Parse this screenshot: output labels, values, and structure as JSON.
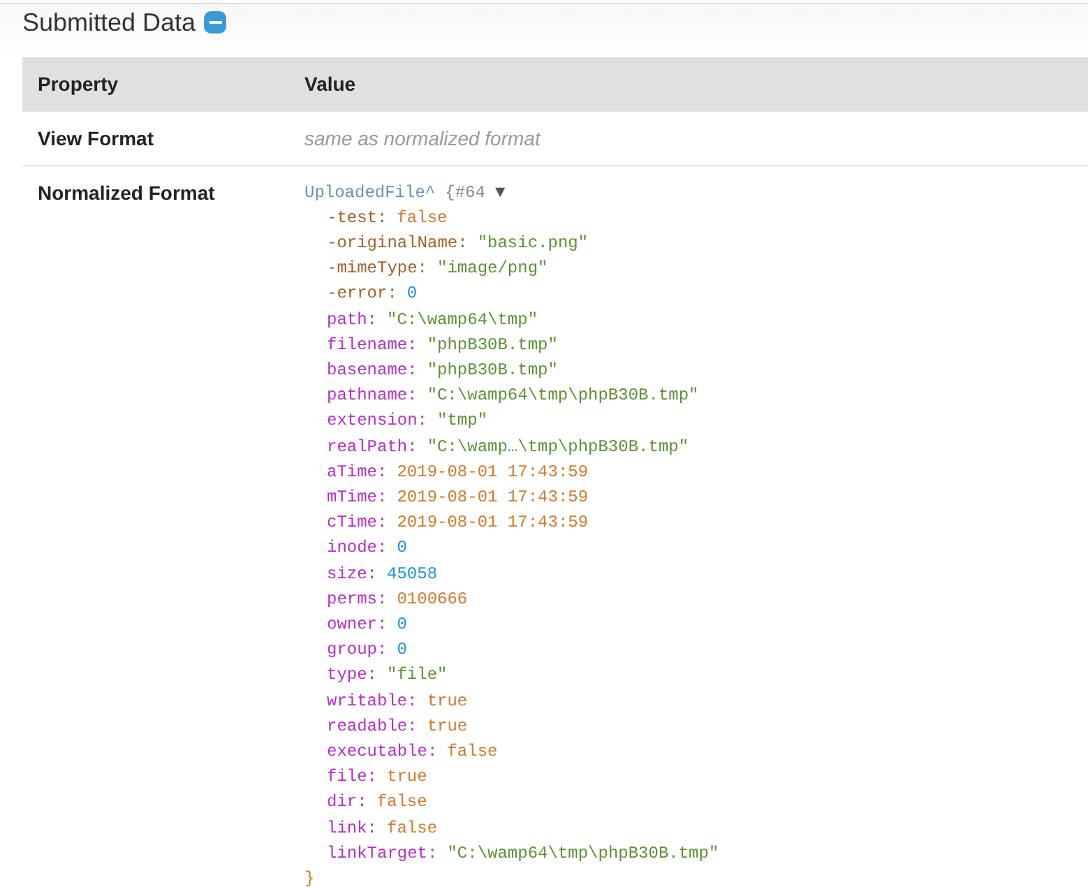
{
  "section": {
    "title": "Submitted Data",
    "expanded": true
  },
  "table": {
    "columns": [
      "Property",
      "Value"
    ],
    "rows": [
      {
        "property": "View Format",
        "kind": "note",
        "value": "same as normalized format"
      },
      {
        "property": "Normalized Format",
        "kind": "dump",
        "dump": {
          "class": "UploadedFile^",
          "ref": "{#64",
          "toggle": "▼",
          "close": "}",
          "expanded": true,
          "protected_fields": [
            {
              "key": "-test:",
              "kind": "const",
              "value": "false"
            },
            {
              "key": "-originalName:",
              "kind": "string",
              "value": "\"basic.png\""
            },
            {
              "key": "-mimeType:",
              "kind": "string",
              "value": "\"image/png\""
            },
            {
              "key": "-error:",
              "kind": "number",
              "value": "0"
            }
          ],
          "public_fields": [
            {
              "key": "path:",
              "kind": "string",
              "value": "\"C:\\wamp64\\tmp\""
            },
            {
              "key": "filename:",
              "kind": "string",
              "value": "\"phpB30B.tmp\""
            },
            {
              "key": "basename:",
              "kind": "string",
              "value": "\"phpB30B.tmp\""
            },
            {
              "key": "pathname:",
              "kind": "string",
              "value": "\"C:\\wamp64\\tmp\\phpB30B.tmp\""
            },
            {
              "key": "extension:",
              "kind": "string",
              "value": "\"tmp\""
            },
            {
              "key": "realPath:",
              "kind": "string",
              "value": "\"C:\\wamp…\\tmp\\phpB30B.tmp\""
            },
            {
              "key": "aTime:",
              "kind": "const",
              "value": "2019-08-01 17:43:59"
            },
            {
              "key": "mTime:",
              "kind": "const",
              "value": "2019-08-01 17:43:59"
            },
            {
              "key": "cTime:",
              "kind": "const",
              "value": "2019-08-01 17:43:59"
            },
            {
              "key": "inode:",
              "kind": "number",
              "value": "0"
            },
            {
              "key": "size:",
              "kind": "number",
              "value": "45058"
            },
            {
              "key": "perms:",
              "kind": "const",
              "value": "0100666"
            },
            {
              "key": "owner:",
              "kind": "number",
              "value": "0"
            },
            {
              "key": "group:",
              "kind": "number",
              "value": "0"
            },
            {
              "key": "type:",
              "kind": "string",
              "value": "\"file\""
            },
            {
              "key": "writable:",
              "kind": "const",
              "value": "true"
            },
            {
              "key": "readable:",
              "kind": "const",
              "value": "true"
            },
            {
              "key": "executable:",
              "kind": "const",
              "value": "false"
            },
            {
              "key": "file:",
              "kind": "const",
              "value": "true"
            },
            {
              "key": "dir:",
              "kind": "const",
              "value": "false"
            },
            {
              "key": "link:",
              "kind": "const",
              "value": "false"
            },
            {
              "key": "linkTarget:",
              "kind": "string",
              "value": "\"C:\\wamp64\\tmp\\phpB30B.tmp\""
            }
          ]
        }
      }
    ]
  }
}
